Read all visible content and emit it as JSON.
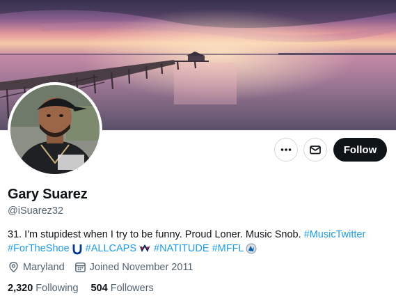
{
  "profile": {
    "name": "Gary Suarez",
    "handle": "@iSuarez32",
    "bio_text": "31. I'm stupidest when I try to be funny. Proud Loner. Music Snob.",
    "hashtags": [
      "#MusicTwitter",
      "#ForTheShoe",
      "#ALLCAPS",
      "#NATITUDE",
      "#MFFL"
    ],
    "location": "Maryland",
    "joined": "Joined November 2011",
    "following_count": "2,320",
    "following_label": "Following",
    "followers_count": "504",
    "followers_label": "Followers"
  },
  "actions": {
    "more_icon": "more-horizontal-icon",
    "message_icon": "envelope-icon",
    "follow_label": "Follow"
  },
  "colors": {
    "link": "#1d9bf0",
    "secondary_text": "#536471",
    "follow_button": "#0f1419"
  }
}
